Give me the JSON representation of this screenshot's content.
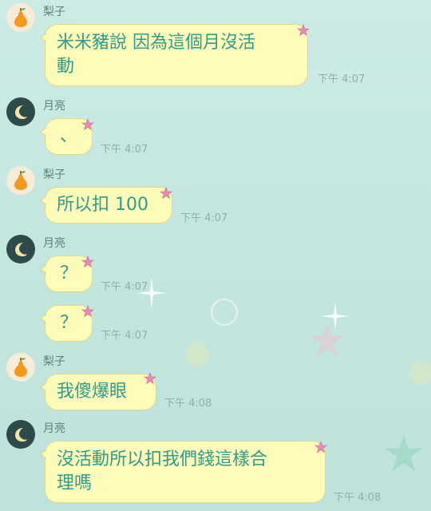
{
  "colors": {
    "bubble_bg": "#fffbb8",
    "bubble_text": "#2e9c8e",
    "timestamp": "#8fb0aa",
    "sender": "#5f7f7a",
    "background": "#c6e7e0"
  },
  "icons": {
    "pear_avatar": "pear-icon",
    "moon_avatar": "moon-icon",
    "bubble_decoration": "pink-star-icon"
  },
  "messages": [
    {
      "sender": "梨子",
      "avatar": "pear",
      "text_lines": [
        "米米豬說 因為這個月沒活",
        "動"
      ],
      "time": "下午 4:07"
    },
    {
      "sender": "月亮",
      "avatar": "moon",
      "text_lines": [
        "、"
      ],
      "time": "下午 4:07"
    },
    {
      "sender": "梨子",
      "avatar": "pear",
      "text_lines": [
        "所以扣 100"
      ],
      "time": "下午 4:07"
    },
    {
      "sender": "月亮",
      "avatar": "moon",
      "text_lines": [
        "？"
      ],
      "time": "下午 4:07"
    },
    {
      "sender": "",
      "avatar": "moon",
      "text_lines": [
        "？"
      ],
      "time": "下午 4:07"
    },
    {
      "sender": "梨子",
      "avatar": "pear",
      "text_lines": [
        "我傻爆眼"
      ],
      "time": "下午 4:08"
    },
    {
      "sender": "月亮",
      "avatar": "moon",
      "text_lines": [
        "沒活動所以扣我們錢這樣合",
        "理嗎"
      ],
      "time": "下午 4:08"
    }
  ]
}
